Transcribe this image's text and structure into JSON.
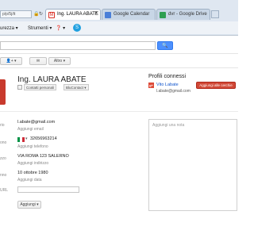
{
  "browser": {
    "address_fragment": "p/p/5j/tt",
    "tabs": [
      {
        "label": "Ing. LAURA ABATE",
        "close": "×",
        "favicon_color": "#d93025"
      },
      {
        "label": "Google Calendar",
        "favicon_color": "#4a7fd8"
      },
      {
        "label": "dvr - Google Drive",
        "favicon_color": "#2e9f52"
      }
    ],
    "menu": {
      "security": "urezza ▾",
      "tools": "Strumenti ▾",
      "help": "❓ ▾"
    }
  },
  "gmail": {
    "search_button": "🔍",
    "toolbar": {
      "add_contact": "👤+ ▾",
      "mail": "✉",
      "more": "Altro ▾"
    }
  },
  "contact": {
    "name": "Ing. LAURA ABATE",
    "groups": [
      "Contatti personali",
      "BluContact ▾"
    ],
    "email": {
      "label": "rio",
      "value": "l.abate@gmail.com",
      "add": "Aggiungi email"
    },
    "phone": {
      "label": "ono",
      "flag": "IT",
      "value": "32656963214",
      "add": "Aggiungi telefono"
    },
    "address": {
      "label": "zzo",
      "line1": "VIA ROMA 123 SALERNO",
      "add": "Aggiungi indirizzo"
    },
    "birthday": {
      "label": "nno",
      "value": "10 ottobre 1980",
      "add": "Aggiungi data"
    },
    "url": {
      "label": "URL",
      "value": ""
    },
    "add_button": "Aggiungi ▾"
  },
  "profiles": {
    "title": "Profili connessi",
    "name": "Vito Labate",
    "email": "l.abate@gmail.com",
    "add_circles": "Aggiungi alle cerchie"
  },
  "note": {
    "placeholder": "Aggiungi una nota"
  },
  "colors": {
    "accent": "#d14836",
    "link": "#1155cc",
    "brand_red": "#dd4b39"
  }
}
